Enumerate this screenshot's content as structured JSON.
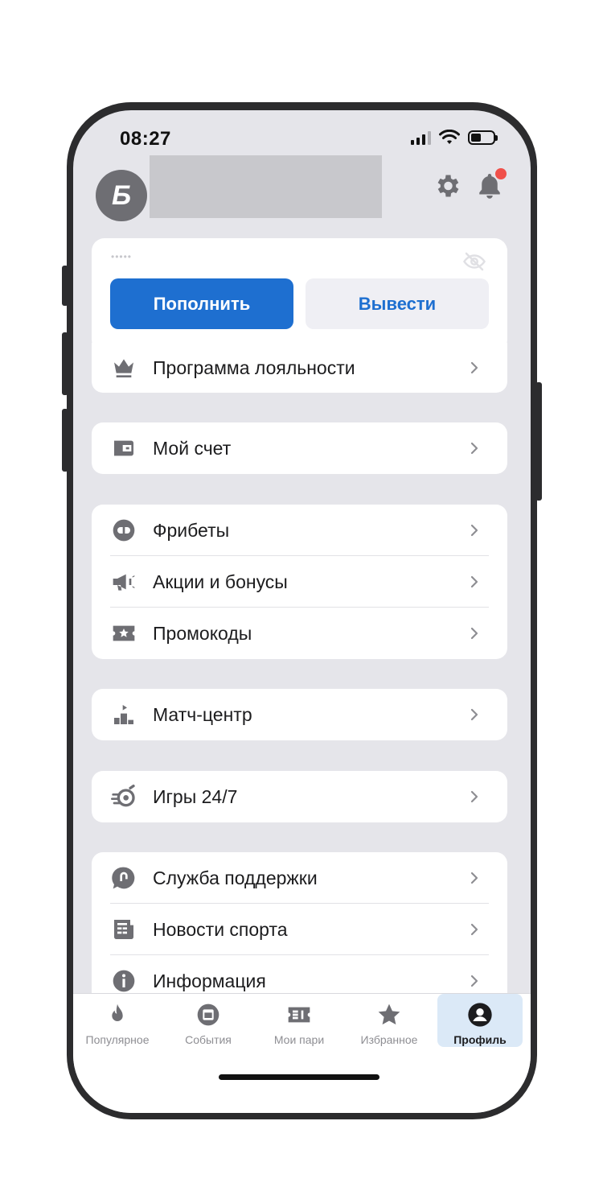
{
  "status_bar": {
    "time": "08:27"
  },
  "header": {
    "avatar_letter": "Б"
  },
  "balance": {
    "masked": "•••••",
    "deposit_label": "Пополнить",
    "withdraw_label": "Вывести"
  },
  "menu": {
    "loyalty": "Программа лояльности",
    "account": "Мой счет",
    "freebets": "Фрибеты",
    "promotions": "Акции и бонусы",
    "promocodes": "Промокоды",
    "match_center": "Матч-центр",
    "games": "Игры 24/7",
    "support": "Служба поддержки",
    "news": "Новости спорта",
    "info": "Информация"
  },
  "tabs": [
    {
      "label": "Популярное",
      "icon": "flame-icon"
    },
    {
      "label": "События",
      "icon": "calendar-icon"
    },
    {
      "label": "Мои пари",
      "icon": "ticket-icon"
    },
    {
      "label": "Избранное",
      "icon": "star-icon"
    },
    {
      "label": "Профиль",
      "icon": "profile-icon",
      "active": true
    }
  ],
  "colors": {
    "accent": "#1e6fd0",
    "notification": "#f0504a",
    "background": "#e5e5ea"
  }
}
